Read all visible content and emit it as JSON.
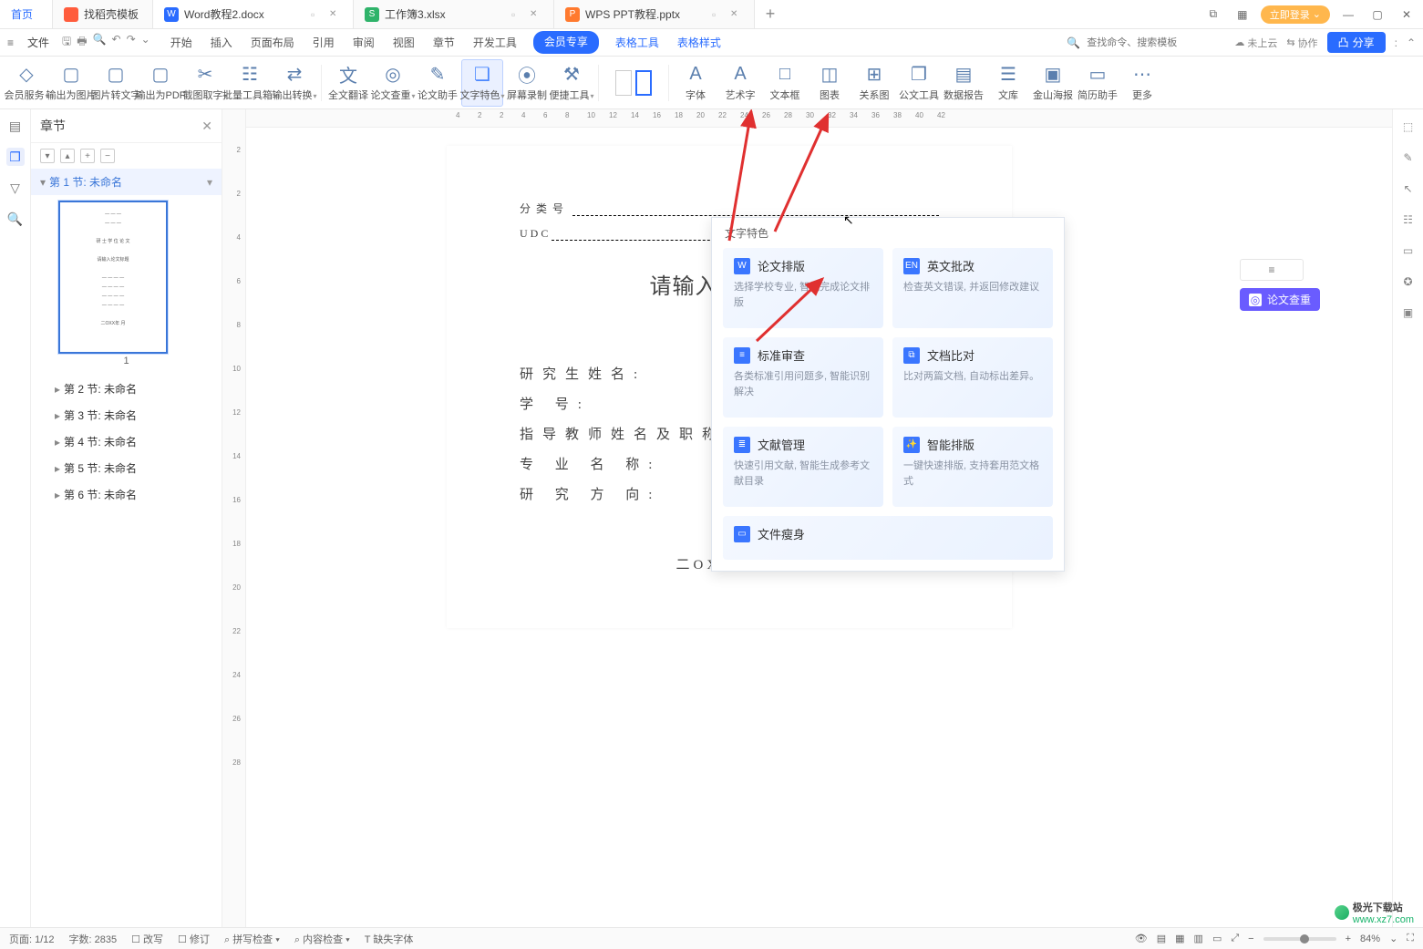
{
  "titlebar": {
    "home": "首页",
    "tabs": [
      {
        "icon": "#ff5c3c",
        "label": "找稻壳模板"
      },
      {
        "icon": "#2a6cff",
        "label": "Word教程2.docx",
        "active": true
      },
      {
        "icon": "#2fb36a",
        "label": "工作簿3.xlsx"
      },
      {
        "icon": "#ff7a2f",
        "label": "WPS PPT教程.pptx"
      }
    ],
    "login": "立即登录"
  },
  "menubar": {
    "file": "文件",
    "tabs": [
      "开始",
      "插入",
      "页面布局",
      "引用",
      "审阅",
      "视图",
      "章节",
      "开发工具"
    ],
    "member": "会员专享",
    "tool_tabs": [
      "表格工具",
      "表格样式"
    ],
    "search_placeholder": "查找命令、搜索模板",
    "cloud": "未上云",
    "coop": "协作",
    "share": "分享"
  },
  "ribbon": [
    {
      "label": "会员服务",
      "dd": true,
      "ico": "◇"
    },
    {
      "label": "输出为图片",
      "ico": "▢"
    },
    {
      "label": "图片转文字",
      "ico": "▢"
    },
    {
      "label": "输出为PDF",
      "ico": "▢"
    },
    {
      "label": "截图取字",
      "dd": true,
      "ico": "✂"
    },
    {
      "label": "批量工具箱",
      "dd": true,
      "ico": "☷"
    },
    {
      "label": "输出转换",
      "dd": true,
      "ico": "⇄"
    },
    {
      "sep": true
    },
    {
      "label": "全文翻译",
      "ico": "文"
    },
    {
      "label": "论文查重",
      "dd": true,
      "ico": "◎"
    },
    {
      "label": "论文助手",
      "ico": "✎"
    },
    {
      "label": "文字特色",
      "dd": true,
      "ico": "❏",
      "hl": true
    },
    {
      "label": "屏幕录制",
      "ico": "⦿"
    },
    {
      "label": "便捷工具",
      "dd": true,
      "ico": "⚒"
    },
    {
      "sep": true
    },
    {
      "pages": true
    },
    {
      "sep": true
    },
    {
      "label": "字体",
      "ico": "A"
    },
    {
      "label": "艺术字",
      "ico": "A"
    },
    {
      "label": "文本框",
      "ico": "□"
    },
    {
      "label": "图表",
      "ico": "◫"
    },
    {
      "label": "关系图",
      "ico": "⊞"
    },
    {
      "label": "公文工具",
      "ico": "❐"
    },
    {
      "label": "数据报告",
      "ico": "▤"
    },
    {
      "label": "文库",
      "ico": "☰"
    },
    {
      "label": "金山海报",
      "ico": "▣"
    },
    {
      "label": "简历助手",
      "ico": "▭"
    },
    {
      "label": "更多",
      "ico": "⋯"
    }
  ],
  "chapters": {
    "title": "章节",
    "active": "第 1 节: 未命名",
    "page_num": "1",
    "rest": [
      "第 2 节: 未命名",
      "第 3 节: 未命名",
      "第 4 节: 未命名",
      "第 5 节: 未命名",
      "第 6 节: 未命名"
    ]
  },
  "dropdown": {
    "title": "文字特色",
    "cards": [
      {
        "name": "论文排版",
        "desc": "选择学校专业, 智能完成论文排版",
        "ico": "W"
      },
      {
        "name": "英文批改",
        "desc": "检查英文错误, 并返回修改建议",
        "ico": "EN"
      },
      {
        "name": "标准审查",
        "desc": "各类标准引用问题多, 智能识别解决",
        "ico": "≡"
      },
      {
        "name": "文档比对",
        "desc": "比对两篇文档, 自动标出差异。",
        "ico": "⧉"
      },
      {
        "name": "文献管理",
        "desc": "快速引用文献, 智能生成参考文献目录",
        "ico": "≣"
      },
      {
        "name": "智能排版",
        "desc": "一键快速排版, 支持套用范文格式",
        "ico": "✨"
      },
      {
        "name": "文件瘦身",
        "desc": "",
        "ico": "▭",
        "half": true
      }
    ]
  },
  "callout": {
    "tag": "论文查重"
  },
  "doc": {
    "line1_label": "分类号",
    "line2_label": "U D C",
    "title": "请输入论文标题",
    "fields": [
      "研究生姓名:",
      "学            号:",
      "指导教师姓名及职称:",
      "专 业 名 称:",
      "研 究 方 向:"
    ],
    "date": "二OXX 年    月"
  },
  "hruler": [
    "4",
    "2",
    "2",
    "4",
    "6",
    "8",
    "10",
    "12",
    "14",
    "16",
    "18",
    "20",
    "22",
    "24",
    "26",
    "28",
    "30",
    "32",
    "34",
    "36",
    "38",
    "40",
    "42"
  ],
  "vruler": [
    "2",
    "2",
    "4",
    "6",
    "8",
    "10",
    "12",
    "14",
    "16",
    "18",
    "20",
    "22",
    "24",
    "26",
    "28"
  ],
  "status": {
    "page": "页面: 1/12",
    "words": "字数: 2835",
    "edit": "改写",
    "track": "修订",
    "spell": "拼写检查 ▾",
    "content": "内容检查 ▾",
    "missing": "缺失字体",
    "zoom": "84%"
  },
  "watermark": {
    "brand": "极光下载站",
    "url": "www.xz7.com"
  }
}
